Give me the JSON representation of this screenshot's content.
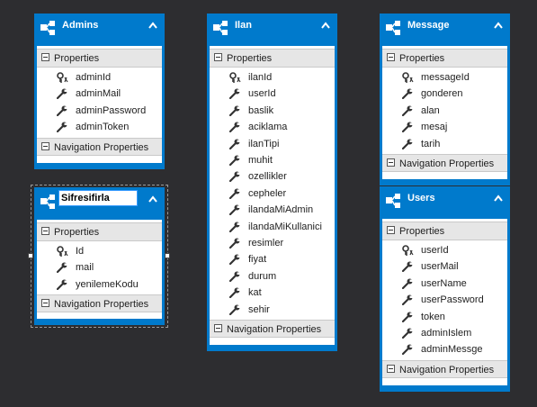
{
  "labels": {
    "properties": "Properties",
    "navigation": "Navigation Properties"
  },
  "entities": {
    "admins": {
      "title": "Admins",
      "properties": [
        "adminId",
        "adminMail",
        "adminPassword",
        "adminToken"
      ]
    },
    "sifresifirla": {
      "title": "Sifresifirla",
      "properties": [
        "Id",
        "mail",
        "yenilemeKodu"
      ]
    },
    "ilan": {
      "title": "Ilan",
      "properties": [
        "ilanId",
        "userId",
        "baslik",
        "aciklama",
        "ilanTipi",
        "muhit",
        "ozellikler",
        "cepheler",
        "ilandaMiAdmin",
        "ilandaMiKullanici",
        "resimler",
        "fiyat",
        "durum",
        "kat",
        "sehir"
      ]
    },
    "message": {
      "title": "Message",
      "properties": [
        "messageId",
        "gonderen",
        "alan",
        "mesaj",
        "tarih"
      ]
    },
    "users": {
      "title": "Users",
      "properties": [
        "userId",
        "userMail",
        "userName",
        "userPassword",
        "token",
        "adminIslem",
        "adminMessge"
      ]
    }
  },
  "keys": {
    "admins": 0,
    "sifresifirla": 0,
    "ilan": 0,
    "message": 0,
    "users": 0
  },
  "colors": {
    "header": "#007acc",
    "canvas": "#2d2d30"
  },
  "icons": {
    "entity": "entity-icon",
    "key": "key-icon",
    "property": "wrench-icon",
    "collapse": "chevron-up-icon"
  }
}
